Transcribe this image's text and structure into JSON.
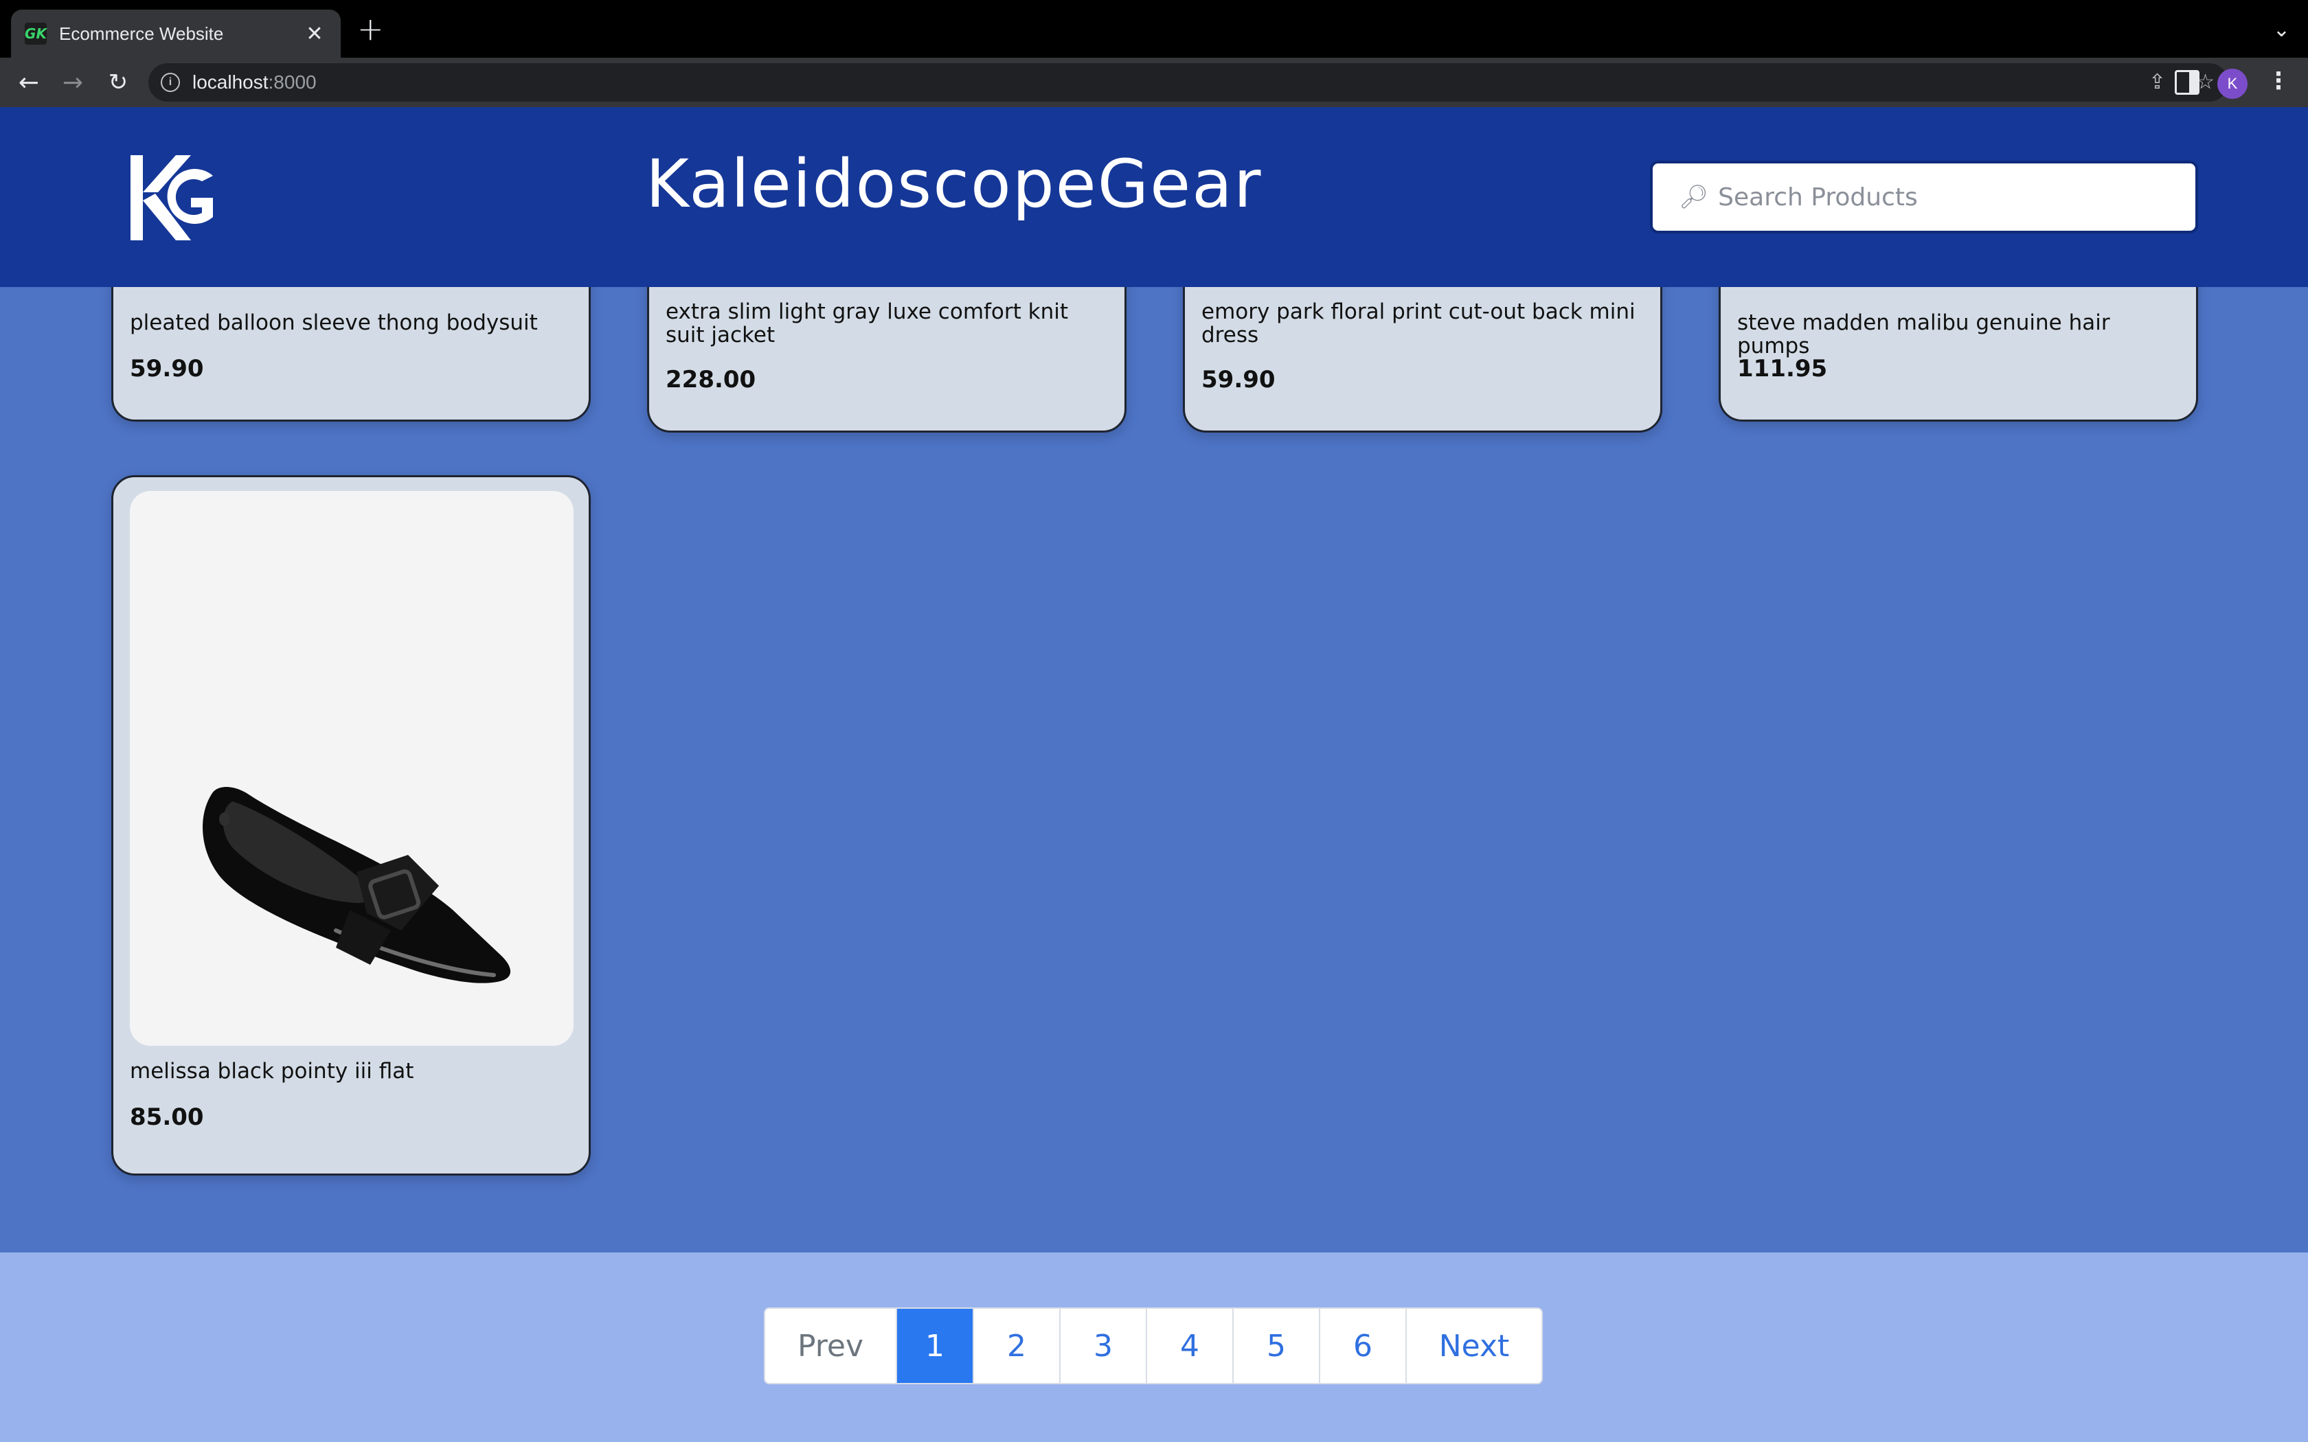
{
  "browser": {
    "tab_title": "Ecommerce Website",
    "favicon_text": "GK",
    "url_host": "localhost",
    "url_port": ":8000",
    "profile_initial": "K"
  },
  "header": {
    "brand": "KaleidoscopeGear",
    "search_placeholder": "Search Products",
    "header_color": "#153797"
  },
  "products_row1": [
    {
      "name": "pleated balloon sleeve thong bodysuit",
      "price": "59.90"
    },
    {
      "name": "extra slim light gray luxe comfort knit suit jacket",
      "price": "228.00"
    },
    {
      "name": "emory park floral print cut-out back mini dress",
      "price": "59.90"
    },
    {
      "name": "steve madden malibu genuine hair pumps",
      "price": "111.95"
    }
  ],
  "products_row2": [
    {
      "name": "melissa black pointy iii flat",
      "price": "85.00",
      "image": "black-pointy-flat-shoe"
    }
  ],
  "pagination": {
    "prev": "Prev",
    "pages": [
      "1",
      "2",
      "3",
      "4",
      "5",
      "6"
    ],
    "active": "1",
    "next": "Next",
    "active_color": "#2a78f0"
  }
}
